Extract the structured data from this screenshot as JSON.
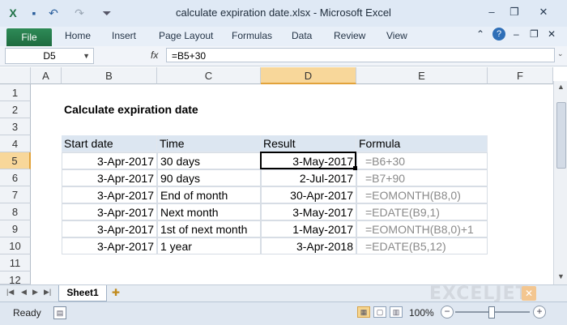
{
  "window": {
    "title": "calculate expiration date.xlsx - Microsoft Excel",
    "minimize": "–",
    "restore": "❐",
    "close": "✕"
  },
  "quick_access": {
    "excel_icon": "excel-icon",
    "save_icon": "save-icon",
    "undo_icon": "undo-icon",
    "redo_icon": "redo-icon"
  },
  "ribbon": {
    "file": "File",
    "tabs": [
      "Home",
      "Insert",
      "Page Layout",
      "Formulas",
      "Data",
      "Review",
      "View"
    ]
  },
  "formula_bar": {
    "name_box": "D5",
    "fx": "fx",
    "formula": "=B5+30"
  },
  "columns": [
    "A",
    "B",
    "C",
    "D",
    "E",
    "F"
  ],
  "rows": [
    "1",
    "2",
    "3",
    "4",
    "5",
    "6",
    "7",
    "8",
    "9",
    "10",
    "11",
    "12"
  ],
  "sheet": {
    "title": "Calculate expiration date",
    "headers": [
      "Start date",
      "Time",
      "Result",
      "Formula"
    ],
    "data": [
      [
        "3-Apr-2017",
        "30 days",
        "3-May-2017",
        "=B6+30"
      ],
      [
        "3-Apr-2017",
        "90 days",
        "2-Jul-2017",
        "=B7+90"
      ],
      [
        "3-Apr-2017",
        "End of month",
        "30-Apr-2017",
        "=EOMONTH(B8,0)"
      ],
      [
        "3-Apr-2017",
        "Next month",
        "3-May-2017",
        "=EDATE(B9,1)"
      ],
      [
        "3-Apr-2017",
        "1st of next month",
        "1-May-2017",
        "=EOMONTH(B8,0)+1"
      ],
      [
        "3-Apr-2017",
        "1 year",
        "3-Apr-2018",
        "=EDATE(B5,12)"
      ]
    ],
    "active_cell": "D5"
  },
  "sheet_tabs": {
    "tabs": [
      "Sheet1"
    ],
    "watermark": "EXCELJET"
  },
  "status_bar": {
    "ready": "Ready",
    "zoom": "100%",
    "zoom_minus": "−",
    "zoom_plus": "+"
  }
}
